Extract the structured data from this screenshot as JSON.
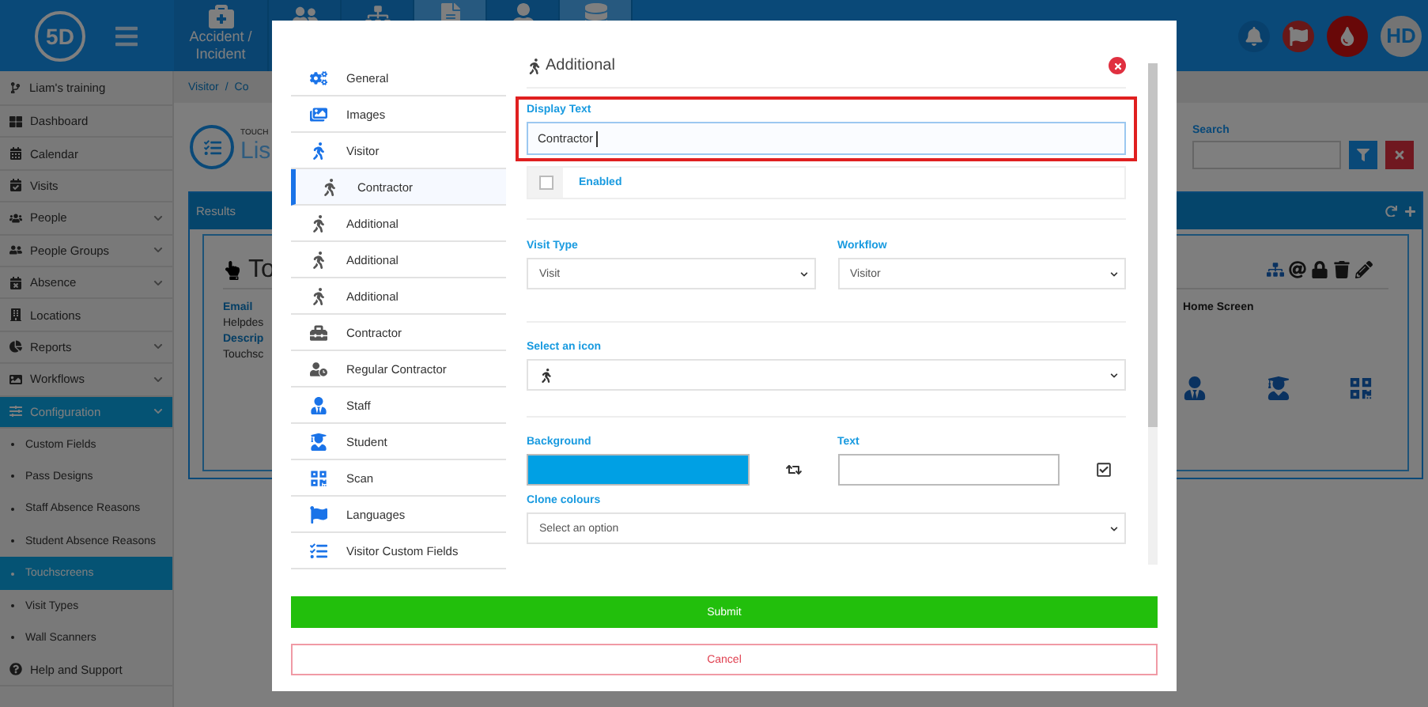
{
  "topbar": {
    "logo": "5D",
    "nav": [
      {
        "label": "Accident / Incident",
        "selected": false
      },
      {
        "selected": false
      },
      {
        "selected": false
      },
      {
        "selected": true
      },
      {
        "selected": false
      },
      {
        "selected": true
      }
    ],
    "user_initials": "HD"
  },
  "sidebar": {
    "account": "Liam's training",
    "items": [
      {
        "label": "Dashboard",
        "selected": false
      },
      {
        "label": "Calendar",
        "selected": false
      },
      {
        "label": "Visits",
        "selected": false
      },
      {
        "label": "People",
        "selected": false,
        "expanded": false
      },
      {
        "label": "People Groups",
        "selected": false,
        "expanded": false
      },
      {
        "label": "Absence",
        "selected": false,
        "expanded": false
      },
      {
        "label": "Locations",
        "selected": false
      },
      {
        "label": "Reports",
        "selected": false,
        "expanded": false
      },
      {
        "label": "Workflows",
        "selected": false,
        "expanded": false
      },
      {
        "label": "Configuration",
        "selected": true,
        "expanded": true,
        "children": [
          {
            "label": "Custom Fields",
            "selected": false
          },
          {
            "label": "Pass Designs",
            "selected": false
          },
          {
            "label": "Staff Absence Reasons",
            "selected": false
          },
          {
            "label": "Student Absence Reasons",
            "selected": false
          },
          {
            "label": "Touchscreens",
            "selected": true
          },
          {
            "label": "Visit Types",
            "selected": false
          },
          {
            "label": "Wall Scanners",
            "selected": false
          }
        ]
      },
      {
        "label": "Help and Support",
        "selected": false
      }
    ]
  },
  "page": {
    "breadcrumbs": [
      "Visitor",
      "/",
      "Co"
    ],
    "subtitle": "TOUCH",
    "title": "Lis",
    "search_label": "Search",
    "results_title": "Results",
    "card_title": "To",
    "fields": [
      {
        "kind": "label",
        "text": "Email"
      },
      {
        "kind": "value",
        "text": "Helpdes"
      },
      {
        "kind": "label",
        "text": "Descrip"
      },
      {
        "kind": "value",
        "text": "Touchsc"
      }
    ],
    "home_screen_label": "Home Screen"
  },
  "modal": {
    "nav": [
      {
        "label": "General",
        "selected": false,
        "color": "#1a73e8"
      },
      {
        "label": "Images",
        "selected": false,
        "color": "#1a73e8"
      },
      {
        "label": "Visitor",
        "selected": false,
        "color": "#1a73e8"
      },
      {
        "label": "Contractor",
        "selected": true,
        "color": "#555555"
      },
      {
        "label": "Additional",
        "selected": false,
        "color": "#555555"
      },
      {
        "label": "Additional",
        "selected": false,
        "color": "#555555"
      },
      {
        "label": "Additional",
        "selected": false,
        "color": "#555555"
      },
      {
        "label": "Contractor",
        "selected": false,
        "color": "#555555"
      },
      {
        "label": "Regular Contractor",
        "selected": false,
        "color": "#555555"
      },
      {
        "label": "Staff",
        "selected": false,
        "color": "#1a73e8"
      },
      {
        "label": "Student",
        "selected": false,
        "color": "#1a73e8"
      },
      {
        "label": "Scan",
        "selected": false,
        "color": "#1a73e8"
      },
      {
        "label": "Languages",
        "selected": false,
        "color": "#1a73e8"
      },
      {
        "label": "Visitor Custom Fields",
        "selected": false,
        "color": "#1a73e8"
      }
    ],
    "title": "Additional",
    "display_text": {
      "label": "Display Text",
      "value": "Contractor",
      "focused": true,
      "highlighted": true
    },
    "enabled": {
      "label": "Enabled",
      "checked": false
    },
    "visit_type": {
      "label": "Visit Type",
      "value": "Visit"
    },
    "workflow": {
      "label": "Workflow",
      "value": "Visitor"
    },
    "icon_select": {
      "label": "Select an icon"
    },
    "background": {
      "label": "Background",
      "color": "#00a0e4"
    },
    "text": {
      "label": "Text",
      "color": "#ffffff"
    },
    "clone": {
      "label": "Clone colours",
      "placeholder": "Select an option"
    },
    "buttons": [
      {
        "kind": "submit",
        "label": "Submit"
      },
      {
        "kind": "cancel",
        "label": "Cancel"
      }
    ]
  }
}
